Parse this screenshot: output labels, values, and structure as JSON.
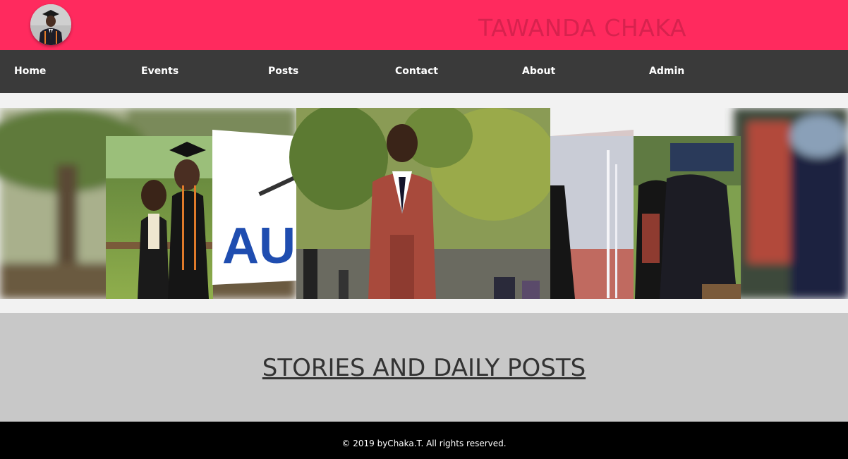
{
  "header": {
    "site_title": "TAWANDA CHAKA"
  },
  "nav": {
    "items": [
      {
        "label": "Home"
      },
      {
        "label": "Events"
      },
      {
        "label": "Posts"
      },
      {
        "label": "Contact"
      },
      {
        "label": "About"
      },
      {
        "label": "Admin"
      }
    ]
  },
  "carousel": {
    "sign_text": "AU"
  },
  "section": {
    "heading": "STORIES AND DAILY POSTS"
  },
  "footer": {
    "copyright": "© 2019 byChaka.T. All rights reserved."
  },
  "colors": {
    "header_bg": "#ff2a5e",
    "nav_bg": "#3a3a3a",
    "section_bg": "#c8c8c8",
    "footer_bg": "#000000"
  }
}
